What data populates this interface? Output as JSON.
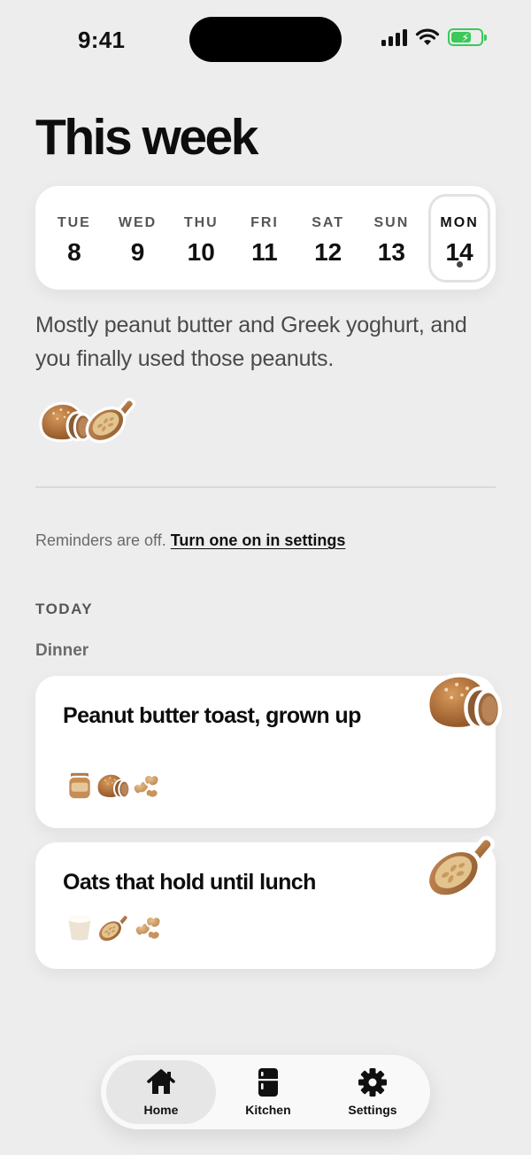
{
  "status_bar": {
    "time": "9:41"
  },
  "page": {
    "title": "This week"
  },
  "week": {
    "days": [
      {
        "name": "TUE",
        "num": "8"
      },
      {
        "name": "WED",
        "num": "9"
      },
      {
        "name": "THU",
        "num": "10"
      },
      {
        "name": "FRI",
        "num": "11"
      },
      {
        "name": "SAT",
        "num": "12"
      },
      {
        "name": "SUN",
        "num": "13"
      },
      {
        "name": "MON",
        "num": "14"
      }
    ],
    "selected_day": "MON 14"
  },
  "summary": {
    "text": "Mostly peanut butter and Greek yoghurt, and you finally used those peanuts."
  },
  "reminder": {
    "text": "Reminders are off. ",
    "link": "Turn one on in settings"
  },
  "today": {
    "section_label": "TODAY",
    "meal_label": "Dinner",
    "meals": [
      {
        "title": "Peanut butter toast, grown up",
        "hero_icon": "bread-loaf-icon",
        "ingredient_icons": [
          "peanut-butter-jar-icon",
          "bread-loaf-icon",
          "peanuts-icon"
        ]
      },
      {
        "title": "Oats that hold until lunch",
        "hero_icon": "oats-scoop-icon",
        "ingredient_icons": [
          "yoghurt-cup-icon",
          "oats-scoop-icon",
          "peanuts-icon"
        ]
      }
    ]
  },
  "tabs": [
    {
      "label": "Home",
      "icon": "house-icon",
      "active": true
    },
    {
      "label": "Kitchen",
      "icon": "fridge-icon",
      "active": false
    },
    {
      "label": "Settings",
      "icon": "gear-icon",
      "active": false
    }
  ],
  "colors": {
    "background": "#ededed",
    "card": "#ffffff",
    "text": "#111111",
    "battery": "#3cc85a"
  }
}
